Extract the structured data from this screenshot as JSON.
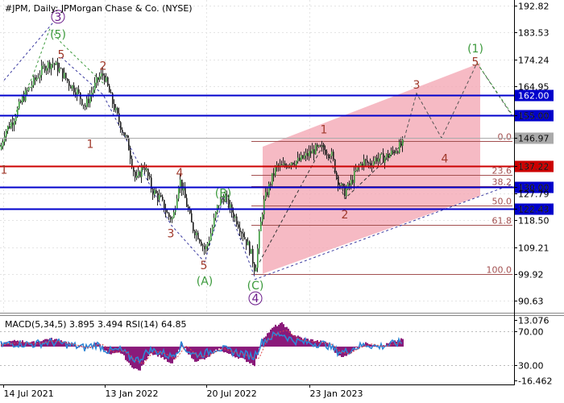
{
  "chart_data": [
    {
      "type": "candlestick",
      "title": "#JPM, Daily:  JPMorgan Chase & Co. (NYSE)",
      "ylim": [
        86.5,
        194.8
      ],
      "y_ticks": [
        "192.82",
        "183.53",
        "174.24",
        "164.95",
        "155.00",
        "146.97",
        "137.22",
        "130.00",
        "127.79",
        "122.43",
        "118.50",
        "109.21",
        "99.92",
        "90.63"
      ],
      "x_tick_labels": [
        "14 Jul 2021",
        "13 Jan 2022",
        "20 Jul 2022",
        "23 Jan 2023"
      ],
      "price_path": [
        [
          0,
          143
        ],
        [
          5,
          149
        ],
        [
          15,
          153
        ],
        [
          28,
          161
        ],
        [
          40,
          166
        ],
        [
          55,
          172
        ],
        [
          65,
          173
        ],
        [
          75,
          170
        ],
        [
          85,
          166
        ],
        [
          95,
          163
        ],
        [
          105,
          158
        ],
        [
          115,
          164
        ],
        [
          122,
          168
        ],
        [
          128,
          169
        ],
        [
          138,
          160
        ],
        [
          148,
          152
        ],
        [
          158,
          145
        ],
        [
          168,
          132
        ],
        [
          178,
          138
        ],
        [
          188,
          129
        ],
        [
          198,
          126
        ],
        [
          208,
          120
        ],
        [
          214,
          119
        ],
        [
          222,
          133
        ],
        [
          230,
          125
        ],
        [
          238,
          116
        ],
        [
          246,
          113
        ],
        [
          254,
          108
        ],
        [
          262,
          115
        ],
        [
          270,
          124
        ],
        [
          278,
          127
        ],
        [
          286,
          122
        ],
        [
          294,
          118
        ],
        [
          302,
          113
        ],
        [
          310,
          108
        ],
        [
          316,
          101
        ],
        [
          320,
          111
        ],
        [
          326,
          124
        ],
        [
          334,
          131
        ],
        [
          342,
          137
        ],
        [
          350,
          137
        ],
        [
          360,
          139
        ],
        [
          370,
          139
        ],
        [
          380,
          141
        ],
        [
          390,
          143
        ],
        [
          400,
          143
        ],
        [
          410,
          142
        ],
        [
          418,
          133
        ],
        [
          426,
          128
        ],
        [
          434,
          131
        ],
        [
          442,
          136
        ],
        [
          450,
          139
        ],
        [
          458,
          138
        ],
        [
          466,
          140
        ],
        [
          474,
          140
        ],
        [
          482,
          141
        ],
        [
          490,
          143
        ],
        [
          500,
          145
        ]
      ],
      "horizontal_levels": [
        {
          "value": 162.0,
          "label": "162.00",
          "color": "#0000cc",
          "kind": "resistance"
        },
        {
          "value": 155.0,
          "label": "155.00",
          "color": "#0000cc",
          "kind": "resistance"
        },
        {
          "value": 146.97,
          "label": "146.97",
          "color": "#aaaaaa",
          "kind": "current"
        },
        {
          "value": 137.22,
          "label": "137.22",
          "color": "#cc0000",
          "kind": "pivot"
        },
        {
          "value": 130.0,
          "label": "130.00",
          "color": "#0000cc",
          "kind": "support"
        },
        {
          "value": 122.43,
          "label": "122.43",
          "color": "#0000cc",
          "kind": "support"
        }
      ],
      "fibonacci": [
        {
          "ratio": "0.0",
          "value": 146.0
        },
        {
          "ratio": "23.6",
          "value": 134.2
        },
        {
          "ratio": "38.2",
          "value": 130.2
        },
        {
          "ratio": "50.0",
          "value": 123.5
        },
        {
          "ratio": "61.8",
          "value": 116.8
        },
        {
          "ratio": "100.0",
          "value": 100.0
        }
      ],
      "wave_labels": [
        {
          "text": "3",
          "color": "#6a1a8a",
          "circled": true,
          "x": 72,
          "y": 189
        },
        {
          "text": "(5)",
          "color": "#3c9a3c",
          "x": 72,
          "y": 183
        },
        {
          "text": "5",
          "color": "#a0392b",
          "x": 76,
          "y": 176
        },
        {
          "text": "2",
          "color": "#a0392b",
          "x": 128,
          "y": 172
        },
        {
          "text": "1",
          "color": "#a0392b",
          "x": 112,
          "y": 145
        },
        {
          "text": "4",
          "color": "#a0392b",
          "x": 223,
          "y": 135
        },
        {
          "text": "1",
          "color": "#a0392b",
          "x": 5,
          "y": 136
        },
        {
          "text": "(B)",
          "color": "#3c9a3c",
          "x": 277,
          "y": 128
        },
        {
          "text": "3",
          "color": "#a0392b",
          "x": 212,
          "y": 114
        },
        {
          "text": "5",
          "color": "#a0392b",
          "x": 253,
          "y": 103
        },
        {
          "text": "(A)",
          "color": "#3c9a3c",
          "x": 254,
          "y": 97.5
        },
        {
          "text": "(C)",
          "color": "#3c9a3c",
          "x": 317,
          "y": 96
        },
        {
          "text": "4",
          "color": "#6a1a8a",
          "circled": true,
          "x": 317,
          "y": 91.5
        },
        {
          "text": "1",
          "color": "#a0392b",
          "x": 402,
          "y": 150
        },
        {
          "text": "2",
          "color": "#a0392b",
          "x": 428,
          "y": 120.5
        },
        {
          "text": "3",
          "color": "#a0392b",
          "x": 517,
          "y": 165.5
        },
        {
          "text": "4",
          "color": "#a0392b",
          "x": 552,
          "y": 140
        },
        {
          "text": "5",
          "color": "#a0392b",
          "x": 590,
          "y": 173.5
        },
        {
          "text": "(1)",
          "color": "#3c9a3c",
          "x": 590,
          "y": 178
        }
      ],
      "forecast_path": [
        [
          500,
          145
        ],
        [
          517,
          162.5
        ],
        [
          548,
          147
        ],
        [
          592,
          173
        ],
        [
          635,
          155
        ]
      ],
      "channel": {
        "color": "#f4a6b4",
        "corners": [
          [
            326,
            144
          ],
          [
            596,
            173
          ],
          [
            596,
            127
          ],
          [
            326,
            100
          ]
        ]
      }
    },
    {
      "type": "histogram",
      "title": "MACD(5,34,5) 3.895 3.494 RSI(14) 64.85",
      "ylim": [
        -18.5,
        15
      ],
      "y_ticks": [
        "13.076",
        "70.00",
        "30.00",
        "-16.462"
      ],
      "rsi_levels": [
        70,
        30
      ],
      "macd_path": [
        [
          0,
          1.5
        ],
        [
          20,
          3
        ],
        [
          40,
          2
        ],
        [
          60,
          4
        ],
        [
          75,
          3
        ],
        [
          90,
          1
        ],
        [
          105,
          -1
        ],
        [
          120,
          2
        ],
        [
          135,
          -4
        ],
        [
          150,
          -3
        ],
        [
          160,
          -9
        ],
        [
          172,
          -12
        ],
        [
          185,
          -3
        ],
        [
          200,
          -5
        ],
        [
          212,
          -9
        ],
        [
          225,
          1
        ],
        [
          240,
          -7
        ],
        [
          255,
          -6
        ],
        [
          270,
          -1
        ],
        [
          285,
          -4
        ],
        [
          300,
          -6
        ],
        [
          315,
          -9
        ],
        [
          325,
          4
        ],
        [
          340,
          10
        ],
        [
          350,
          11.5
        ],
        [
          362,
          6
        ],
        [
          375,
          4
        ],
        [
          390,
          3
        ],
        [
          405,
          2
        ],
        [
          418,
          -4
        ],
        [
          428,
          -5
        ],
        [
          440,
          -1
        ],
        [
          455,
          2
        ],
        [
          470,
          0
        ],
        [
          485,
          2
        ],
        [
          500,
          3.9
        ]
      ]
    }
  ]
}
